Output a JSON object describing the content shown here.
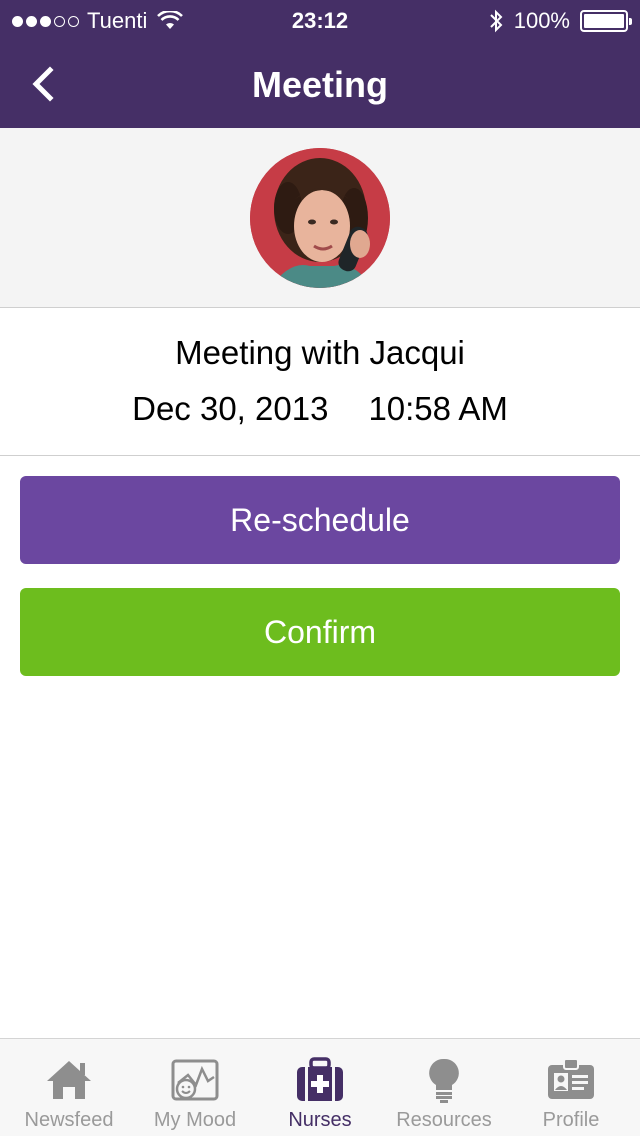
{
  "status_bar": {
    "carrier": "Tuenti",
    "signal_filled": 3,
    "signal_total": 5,
    "time": "23:12",
    "battery": "100%",
    "battery_level": 1.0,
    "icons": [
      "wifi-icon",
      "bluetooth-icon",
      "battery-icon"
    ]
  },
  "nav": {
    "title": "Meeting",
    "back_icon": "chevron-left-icon"
  },
  "meeting": {
    "title": "Meeting with Jacqui",
    "date": "Dec 30, 2013",
    "time": "10:58 AM"
  },
  "actions": {
    "reschedule_label": "Re-schedule",
    "confirm_label": "Confirm"
  },
  "tabs": [
    {
      "label": "Newsfeed",
      "icon": "home-icon",
      "active": false
    },
    {
      "label": "My Mood",
      "icon": "mood-chart-icon",
      "active": false
    },
    {
      "label": "Nurses",
      "icon": "medical-bag-icon",
      "active": true
    },
    {
      "label": "Resources",
      "icon": "lightbulb-icon",
      "active": false
    },
    {
      "label": "Profile",
      "icon": "id-card-icon",
      "active": false
    }
  ],
  "colors": {
    "header": "#452f66",
    "reschedule": "#6b47a0",
    "confirm": "#6dbd1e",
    "tab_inactive": "#9a9a9a",
    "tab_active": "#452f66"
  }
}
